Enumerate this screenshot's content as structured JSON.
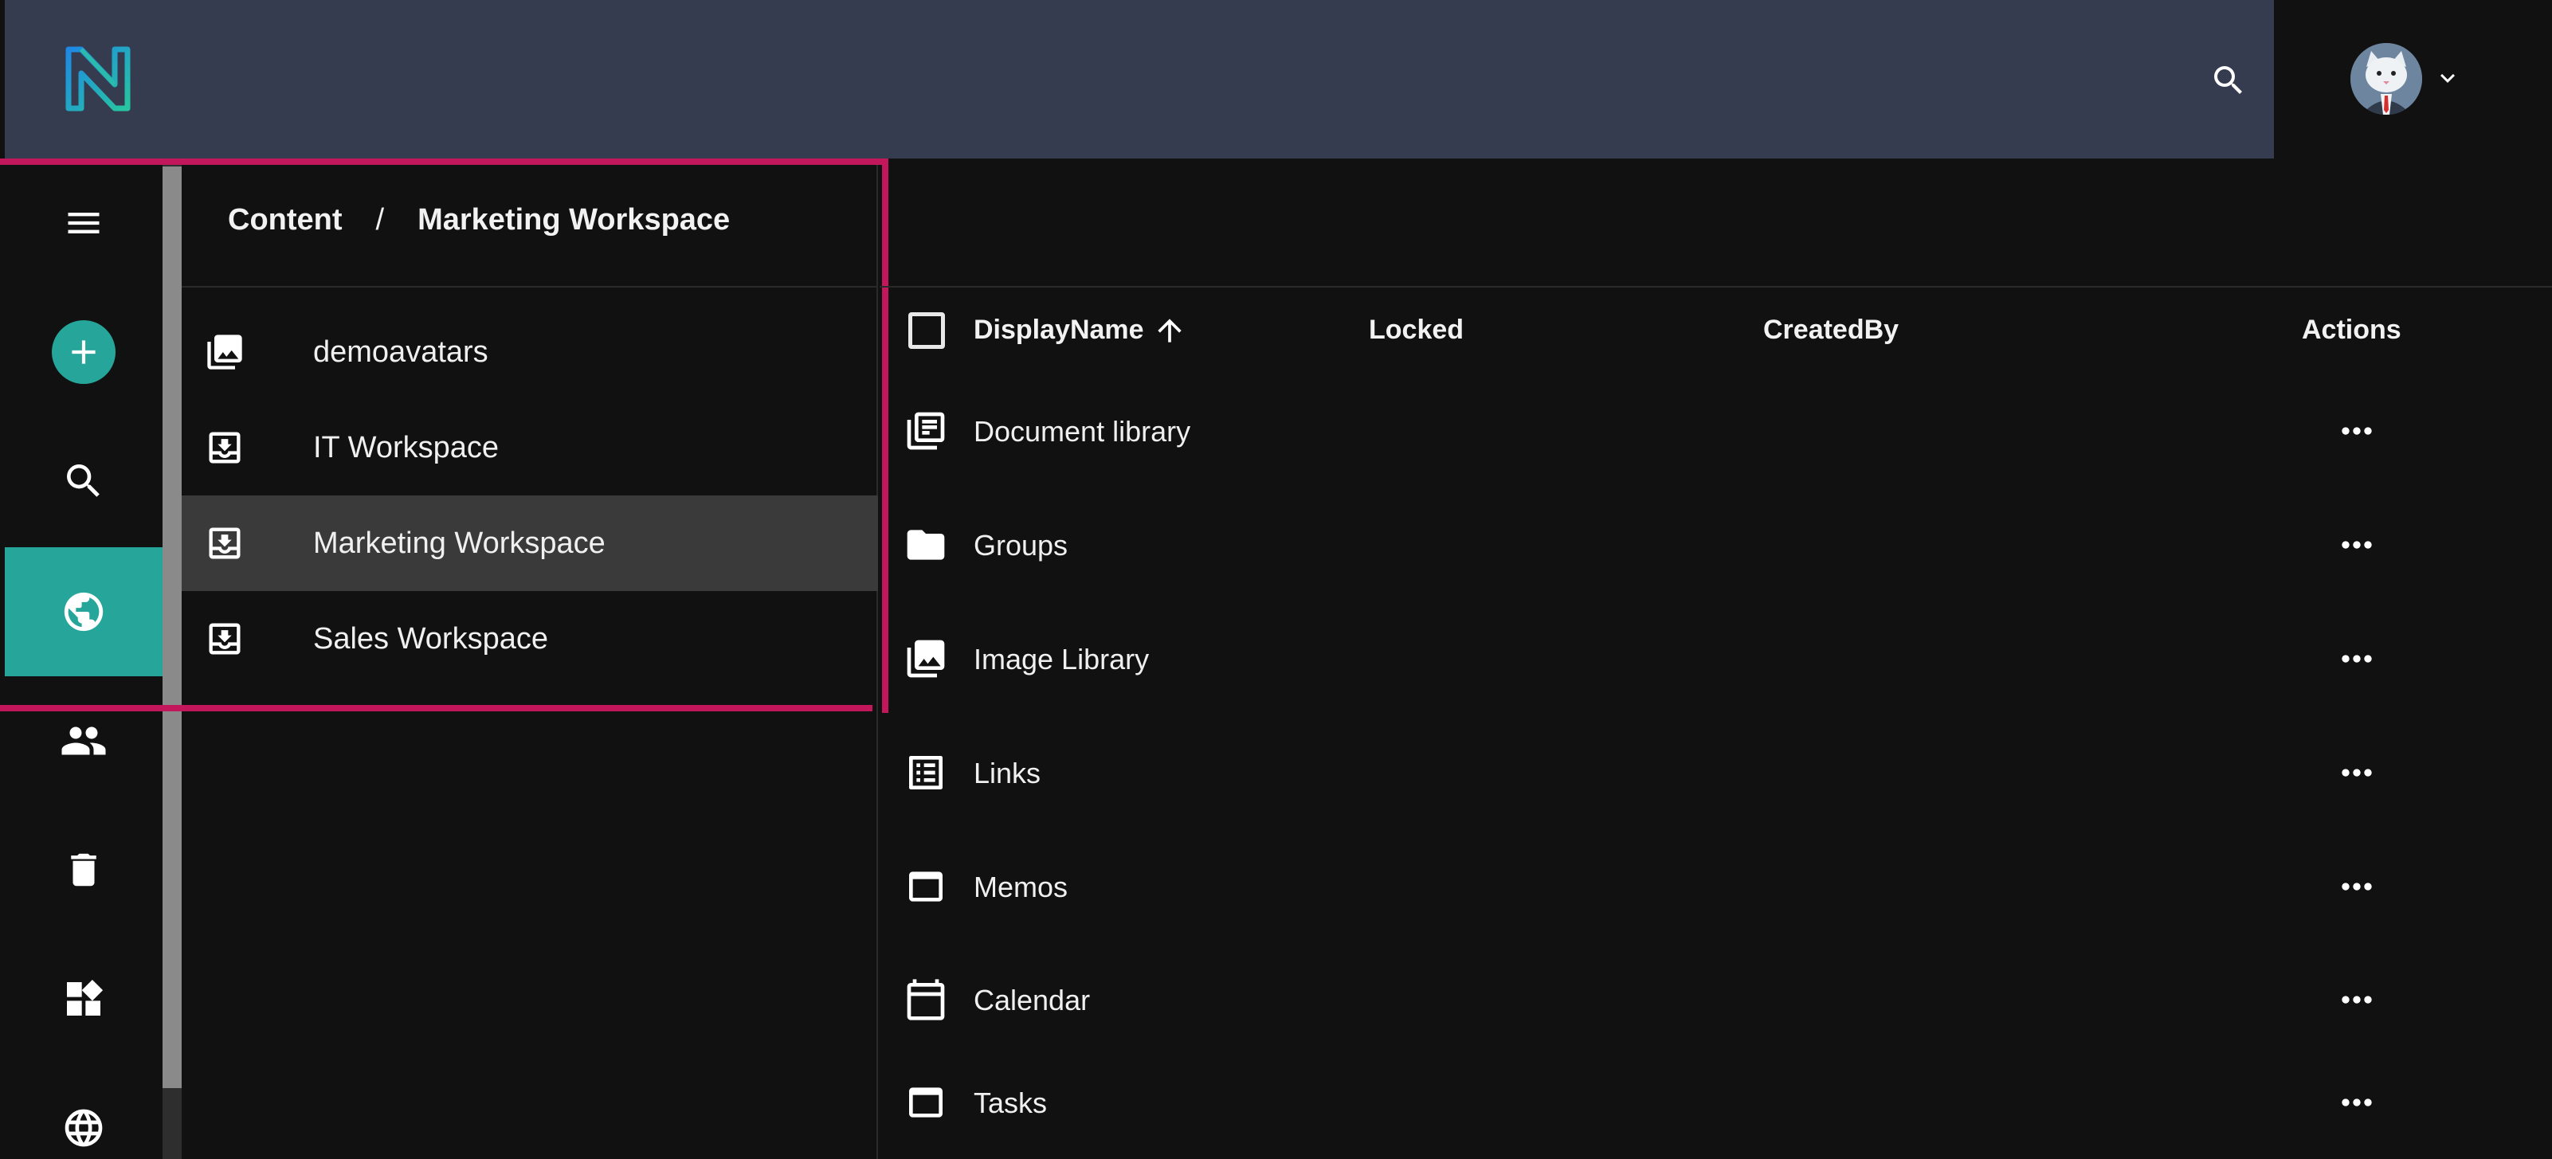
{
  "header": {
    "logo_icon": "sn-logo-icon",
    "search_icon": "search-icon",
    "user_menu_icon": "chevron-down-icon"
  },
  "rail": {
    "items": [
      {
        "name": "menu",
        "icon": "hamburger-icon"
      },
      {
        "name": "add",
        "icon": "plus-icon"
      },
      {
        "name": "search",
        "icon": "search-icon"
      },
      {
        "name": "content",
        "icon": "globe-icon",
        "active": true
      },
      {
        "name": "users",
        "icon": "people-icon"
      },
      {
        "name": "trash",
        "icon": "trash-icon"
      },
      {
        "name": "apps",
        "icon": "widgets-icon"
      },
      {
        "name": "localization",
        "icon": "language-icon"
      }
    ],
    "active_color": "#26a69a"
  },
  "breadcrumb": {
    "root": "Content",
    "separator": "/",
    "current": "Marketing Workspace"
  },
  "tree": {
    "items": [
      {
        "label": "demoavatars",
        "icon": "image-library-icon"
      },
      {
        "label": "IT Workspace",
        "icon": "workspace-icon"
      },
      {
        "label": "Marketing Workspace",
        "icon": "workspace-icon",
        "selected": true
      },
      {
        "label": "Sales Workspace",
        "icon": "workspace-icon"
      }
    ]
  },
  "table": {
    "columns": {
      "display_name": "DisplayName",
      "locked": "Locked",
      "created_by": "CreatedBy",
      "actions": "Actions"
    },
    "sort": {
      "column": "DisplayName",
      "direction": "ascending"
    },
    "rows": [
      {
        "label": "Document library",
        "icon": "document-library-icon",
        "locked": "",
        "created_by": ""
      },
      {
        "label": "Groups",
        "icon": "folder-icon",
        "locked": "",
        "created_by": ""
      },
      {
        "label": "Image Library",
        "icon": "image-library-icon",
        "locked": "",
        "created_by": ""
      },
      {
        "label": "Links",
        "icon": "list-icon",
        "locked": "",
        "created_by": ""
      },
      {
        "label": "Memos",
        "icon": "window-icon",
        "locked": "",
        "created_by": ""
      },
      {
        "label": "Calendar",
        "icon": "calendar-icon",
        "locked": "",
        "created_by": ""
      },
      {
        "label": "Tasks",
        "icon": "window-icon",
        "locked": "",
        "created_by": ""
      }
    ]
  },
  "colors": {
    "header_bg": "#363c50",
    "accent": "#26a69a",
    "highlight_frame": "#c2185b",
    "background": "#111111"
  }
}
